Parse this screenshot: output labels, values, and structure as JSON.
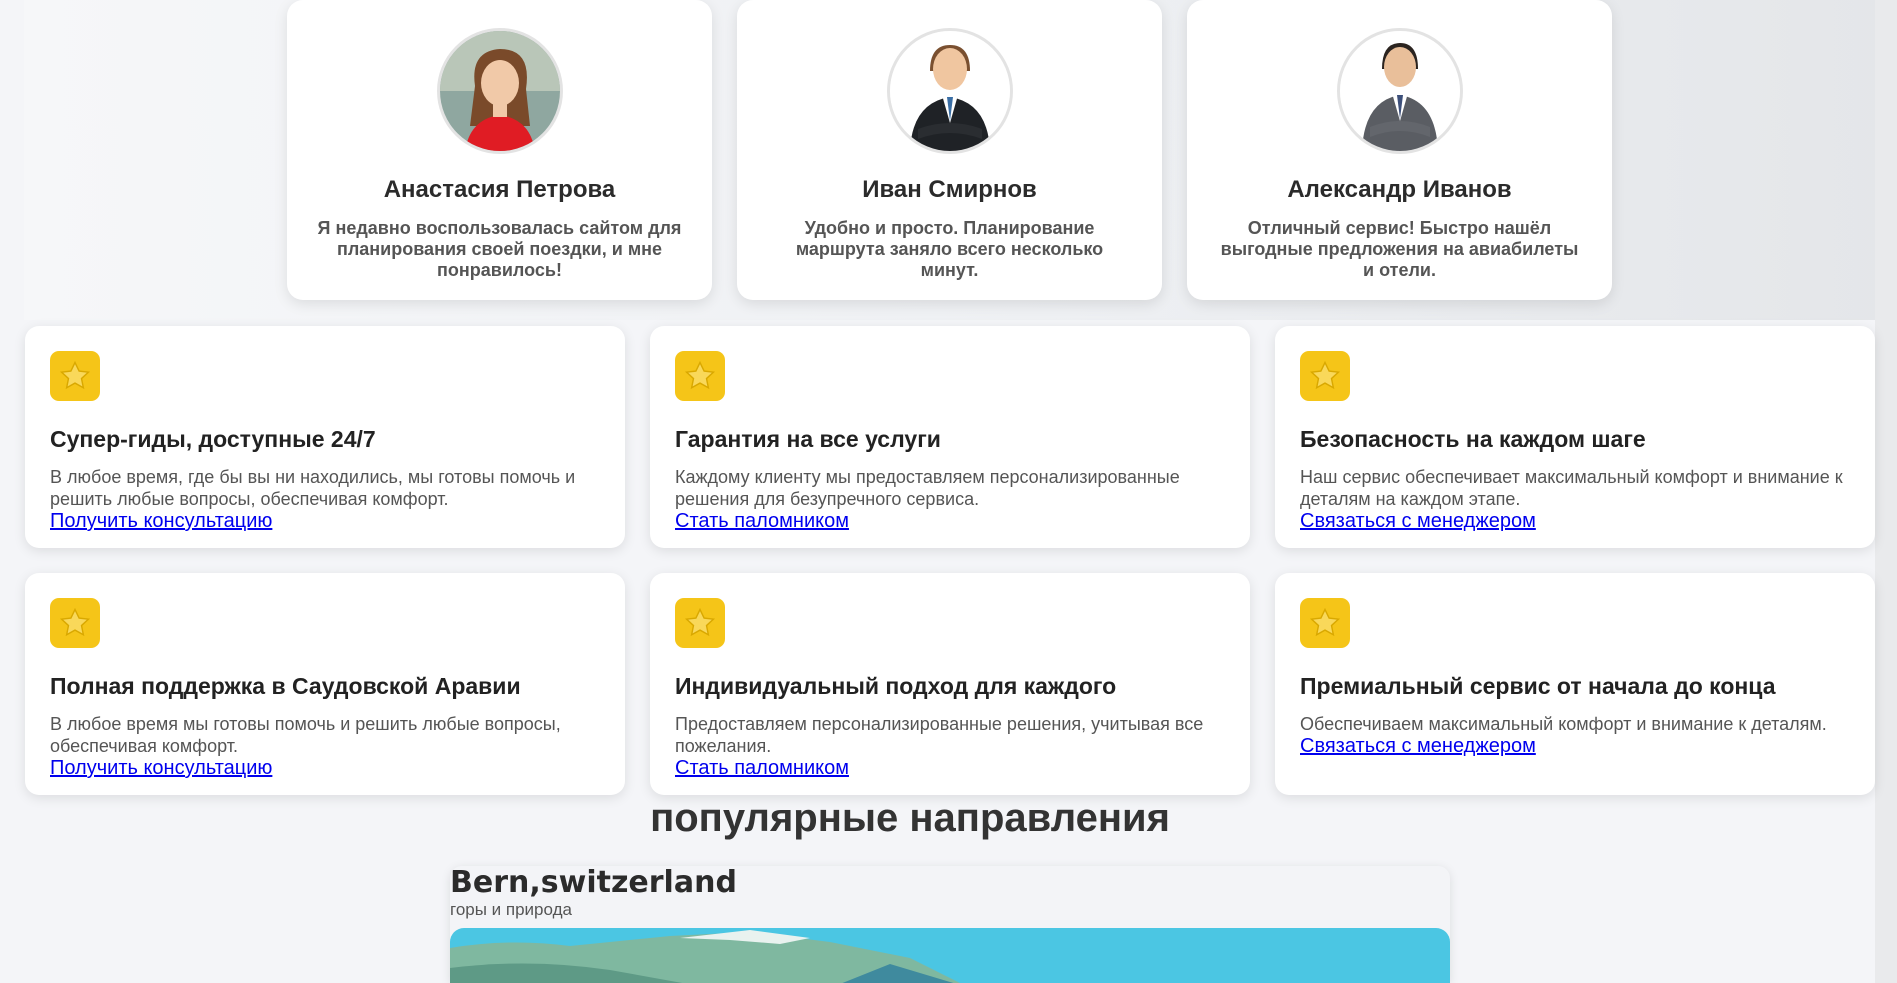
{
  "reviews": [
    {
      "name": "Анастасия Петрова",
      "text": "Я недавно воспользовалась сайтом для планирования своей поездки, и мне понравилось!",
      "avatar": "woman-red-avatar"
    },
    {
      "name": "Иван Смирнов",
      "text": "Удобно и просто. Планирование маршрута заняло всего несколько минут.",
      "avatar": "man-black-suit-avatar"
    },
    {
      "name": "Александр Иванов",
      "text": "Отличный сервис! Быстро нашёл выгодные предложения на авиабилеты и отели.",
      "avatar": "man-grey-suit-avatar"
    }
  ],
  "features": [
    {
      "icon": "star-icon",
      "title": "Супер-гиды, доступные 24/7",
      "desc": "В любое время, где бы вы ни находились, мы готовы помочь и решить любые вопросы, обеспечивая комфорт.",
      "link": "Получить консультацию"
    },
    {
      "icon": "star-icon",
      "title": "Гарантия на все услуги",
      "desc": "Каждому клиенту мы предоставляем персонализированные решения для безупречного сервиса.",
      "link": "Стать паломником"
    },
    {
      "icon": "star-icon",
      "title": "Безопасность на каждом шаге",
      "desc": "Наш сервис обеспечивает максимальный комфорт и внимание к деталям на каждом этапе.",
      "link": "Связаться с менеджером"
    },
    {
      "icon": "star-icon",
      "title": "Полная поддержка в Саудовской Аравии",
      "desc": "В любое время мы готовы помочь и решить любые вопросы, обеспечивая комфорт.",
      "link": "Получить консультацию"
    },
    {
      "icon": "star-icon",
      "title": "Индивидуальный подход для каждого",
      "desc": "Предоставляем персонализированные решения, учитывая все пожелания.",
      "link": "Стать паломником"
    },
    {
      "icon": "star-icon",
      "title": "Премиальный сервис от начала до конца",
      "desc": "Обеспечиваем максимальный комфорт и внимание к деталям.",
      "link": "Связаться с менеджером"
    }
  ],
  "popular": {
    "title": "популярные направления",
    "destination": {
      "name": "Bern,switzerland",
      "subtitle": "горы и природа"
    }
  },
  "colors": {
    "accent_star": "#f5c518",
    "link": "#0000ee"
  }
}
